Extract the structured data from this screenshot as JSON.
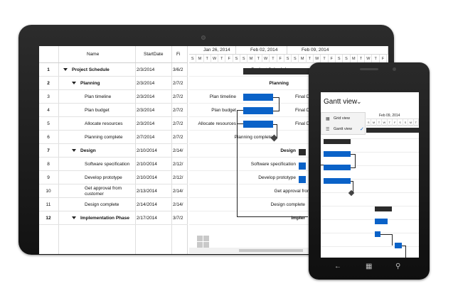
{
  "grid": {
    "columns": [
      "Name",
      "StartDate",
      "Fi"
    ],
    "rows": [
      {
        "id": "1",
        "name": "Project Schedule",
        "start": "2/3/2014",
        "finish": "3/6/2",
        "level": 0,
        "summary": true
      },
      {
        "id": "2",
        "name": "Planning",
        "start": "2/3/2014",
        "finish": "2/7/2",
        "level": 1,
        "summary": true
      },
      {
        "id": "3",
        "name": "Plan timeline",
        "start": "2/3/2014",
        "finish": "2/7/2",
        "level": 2,
        "summary": false
      },
      {
        "id": "4",
        "name": "Plan budget",
        "start": "2/3/2014",
        "finish": "2/7/2",
        "level": 2,
        "summary": false
      },
      {
        "id": "5",
        "name": "Allocate resources",
        "start": "2/3/2014",
        "finish": "2/7/2",
        "level": 2,
        "summary": false
      },
      {
        "id": "6",
        "name": "Planning complete",
        "start": "2/7/2014",
        "finish": "2/7/2",
        "level": 2,
        "summary": false
      },
      {
        "id": "7",
        "name": "Design",
        "start": "2/10/2014",
        "finish": "2/14/",
        "level": 1,
        "summary": true
      },
      {
        "id": "8",
        "name": "Software specification",
        "start": "2/10/2014",
        "finish": "2/12/",
        "level": 2,
        "summary": false
      },
      {
        "id": "9",
        "name": "Develop prototype",
        "start": "2/10/2014",
        "finish": "2/12/",
        "level": 2,
        "summary": false
      },
      {
        "id": "10",
        "name": "Get approval from customer",
        "start": "2/13/2014",
        "finish": "2/14/",
        "level": 2,
        "summary": false
      },
      {
        "id": "11",
        "name": "Design complete",
        "start": "2/14/2014",
        "finish": "2/14/",
        "level": 2,
        "summary": false
      },
      {
        "id": "12",
        "name": "Implementation Phase",
        "start": "2/17/2014",
        "finish": "3/7/2",
        "level": 1,
        "summary": true
      }
    ]
  },
  "chart": {
    "weeks": [
      "Jan 26, 2014",
      "Feb 02, 2014",
      "Feb 09, 2014"
    ],
    "day_letters": [
      "S",
      "M",
      "T",
      "W",
      "T",
      "F",
      "S",
      "S",
      "M",
      "T",
      "W",
      "T",
      "F",
      "S",
      "S",
      "M",
      "T",
      "W",
      "T",
      "F",
      "S",
      "S",
      "M",
      "T",
      "W",
      "T",
      "F"
    ],
    "labels": [
      "Project Schedule",
      "Planning",
      "Plan timeline",
      "Plan budget",
      "Allocate resources",
      "Planning complete",
      "Design",
      "Software specification",
      "Develop prototype",
      "Get approval from customer",
      "Design complete",
      "Impler"
    ],
    "bar_trailing": [
      "",
      "",
      "Final D",
      "Final D",
      "Final D",
      "",
      "",
      "",
      "",
      "",
      "",
      ""
    ]
  },
  "phone": {
    "view_title": "Gantt view",
    "menu": [
      {
        "label": "Grid view",
        "icon": "grid-icon",
        "checked": false
      },
      {
        "label": "Gantt view",
        "icon": "gantt-icon",
        "checked": true
      }
    ],
    "week": "Feb 09, 2014",
    "day_letters": [
      "S",
      "M",
      "T",
      "W",
      "T",
      "F",
      "S",
      "S",
      "M",
      "T"
    ],
    "nav_icons": [
      "back-icon",
      "windows-icon",
      "search-icon"
    ]
  }
}
